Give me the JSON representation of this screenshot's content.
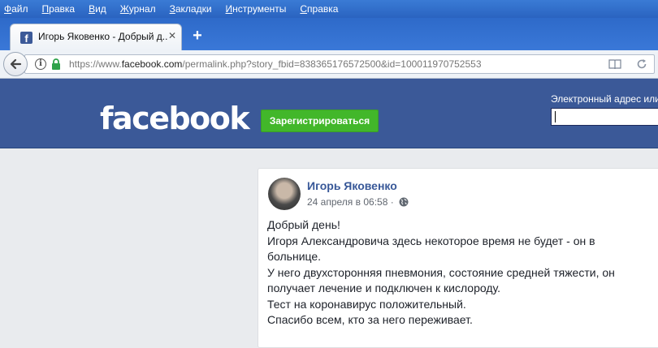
{
  "menubar": {
    "items": [
      {
        "label": "Файл",
        "key": "Ф",
        "rest": "айл"
      },
      {
        "label": "Правка",
        "key": "П",
        "rest": "равка"
      },
      {
        "label": "Вид",
        "key": "В",
        "rest": "ид"
      },
      {
        "label": "Журнал",
        "key": "Ж",
        "rest": "урнал"
      },
      {
        "label": "Закладки",
        "key": "З",
        "rest": "акладки"
      },
      {
        "label": "Инструменты",
        "key": "И",
        "rest": "нструменты"
      },
      {
        "label": "Справка",
        "key": "С",
        "rest": "правка"
      }
    ]
  },
  "tab": {
    "title": "Игорь Яковенко - Добрый д...",
    "close_glyph": "✕",
    "favicon_glyph": "f"
  },
  "newtab_glyph": "+",
  "address_bar": {
    "url_prefix": "https://www.",
    "url_host": "facebook.com",
    "url_path": "/permalink.php?story_fbid=838365176572500&id=100011970752553"
  },
  "fb_header": {
    "logo": "facebook",
    "signup_label": "Зарегистрироваться",
    "email_label": "Электронный адрес или",
    "email_value": ""
  },
  "post": {
    "author": "Игорь Яковенко",
    "timestamp": "24 апреля в 06:58 ·",
    "lines": [
      "Добрый день!",
      "Игоря Александровича здесь некоторое время не будет - он в больнице.",
      "У него двухсторонняя пневмония, состояние средней тяжести, он получает лечение и подключен к кислороду.",
      "Тест на коронавирус положительный.",
      "Спасибо всем, кто за него переживает."
    ]
  },
  "colors": {
    "fb_blue": "#3b5998",
    "signup_green": "#42b72a",
    "author_link": "#385898"
  },
  "icons": {
    "back": "back-arrow-icon",
    "info": "info-icon",
    "lock": "lock-icon",
    "reader": "reader-view-icon",
    "reload": "reload-icon",
    "globe": "globe-icon"
  }
}
